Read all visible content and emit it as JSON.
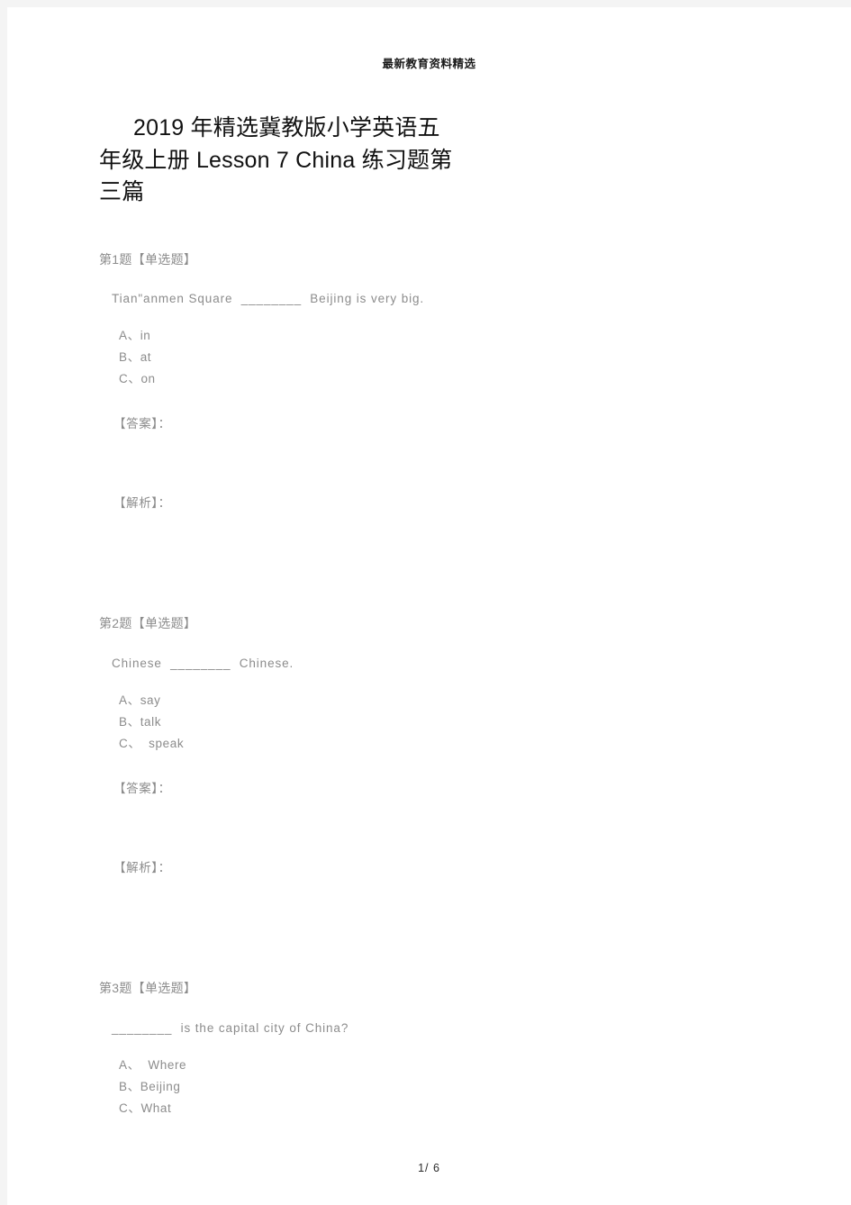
{
  "header": {
    "running_head": "最新教育资料精选"
  },
  "title": "2019 年精选冀教版小学英语五年级上册 Lesson 7 China 练习题第三篇",
  "questions": [
    {
      "head": "第1题【单选题】",
      "stem": "Tian\"anmen Square  ________  Beijing is very big.",
      "options": [
        "A、in",
        "B、at",
        "C、on"
      ],
      "answer_label": "【答案】：",
      "answer_value": "",
      "analysis_label": "【解析】：",
      "analysis_value": ""
    },
    {
      "head": "第2题【单选题】",
      "stem": "Chinese  ________  Chinese.",
      "options": [
        "A、say",
        "B、talk",
        "C、  speak"
      ],
      "answer_label": "【答案】：",
      "answer_value": "",
      "analysis_label": "【解析】：",
      "analysis_value": ""
    },
    {
      "head": "第3题【单选题】",
      "stem": "________  is the capital city of China?",
      "options": [
        "A、  Where",
        "B、Beijing",
        "C、What"
      ],
      "answer_label": "",
      "answer_value": "",
      "analysis_label": "",
      "analysis_value": ""
    }
  ],
  "footer": {
    "page_indicator": "1/ 6"
  },
  "colors": {
    "page_background": "#ffffff",
    "canvas_background": "#f4f4f4",
    "body_text": "#8c8c8c",
    "title_text": "#111111",
    "header_text": "#1a1a1a"
  }
}
